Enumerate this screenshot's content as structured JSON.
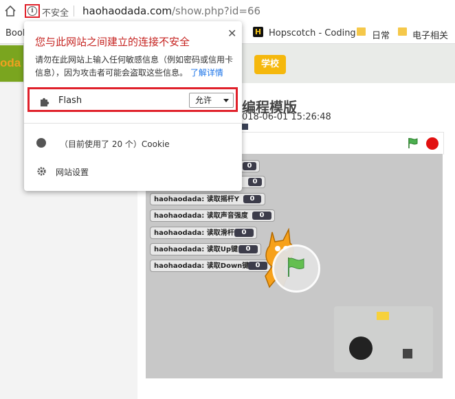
{
  "address_bar": {
    "not_secure_label": "不安全",
    "url_host": "haohaodada.com",
    "url_path": "/show.php?id=66"
  },
  "bookmarks": [
    {
      "label": "Book",
      "icon": "none"
    },
    {
      "label": "Hopscotch - Coding",
      "icon": "hopscotch-icon"
    },
    {
      "label": "日常",
      "icon": "folder-icon"
    },
    {
      "label": "电子相关",
      "icon": "folder-icon"
    }
  ],
  "site": {
    "logo_text": "oda",
    "school_button": "学校",
    "title": "编程模版",
    "date": "018-06-01 15:26:48"
  },
  "stage": {
    "monitors": [
      {
        "label": "haohaodada: 读取摇杆Y",
        "value": "0"
      },
      {
        "label": "haohaodada: 读取声音强度",
        "value": "0"
      },
      {
        "label": "haohaodada: 读取滑杆",
        "value": "0"
      },
      {
        "label": "haohaodada: 读取Up键",
        "value": "0"
      },
      {
        "label": "haohaodada: 读取Down键",
        "value": "0"
      }
    ],
    "partial_values": [
      "0",
      "0"
    ]
  },
  "popup": {
    "title": "您与此网站之间建立的连接不安全",
    "desc": "请勿在此网站上输入任何敏感信息（例如密码或信用卡信息），因为攻击者可能会盗取这些信息。",
    "learn_more": "了解详情",
    "flash_label": "Flash",
    "flash_select": "允许",
    "cookie_text": "（目前使用了 20 个）Cookie",
    "settings_label": "网站设置"
  },
  "colors": {
    "warning_red": "#c5221f",
    "highlight_red": "#e0202a",
    "link_blue": "#1a73e8",
    "site_green": "#7aa51f",
    "school_yellow": "#f5b80d"
  }
}
